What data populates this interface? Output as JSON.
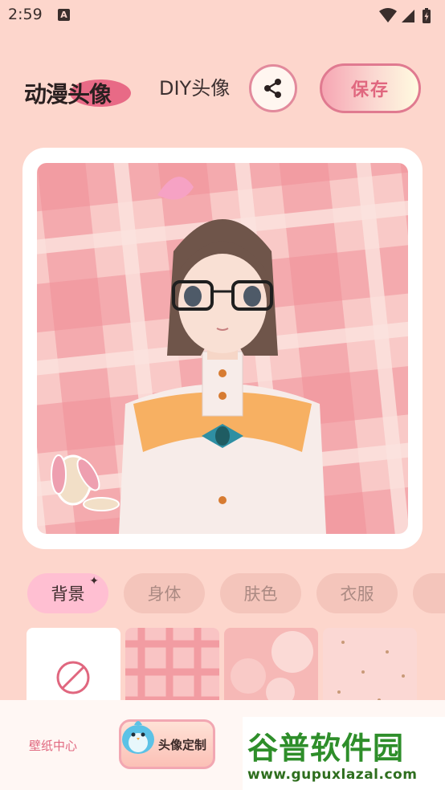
{
  "status_bar": {
    "time": "2:59",
    "notification_letter": "A"
  },
  "header": {
    "logo_text": "动漫头像",
    "title": "DIY头像",
    "save_label": "保存"
  },
  "tabs": [
    {
      "label": "背景",
      "active": true,
      "sparkle": "✦"
    },
    {
      "label": "身体",
      "active": false
    },
    {
      "label": "肤色",
      "active": false
    },
    {
      "label": "衣服",
      "active": false
    }
  ],
  "bottom_nav": {
    "wallpaper_label": "壁纸中心",
    "avatar_label": "头像定制"
  },
  "watermark": {
    "main": "谷普软件园",
    "sub": "www.gupuxlazal.com"
  },
  "colors": {
    "background": "#fdd6cc",
    "accent": "#e0677f",
    "tab_active": "#ffbfd2"
  }
}
